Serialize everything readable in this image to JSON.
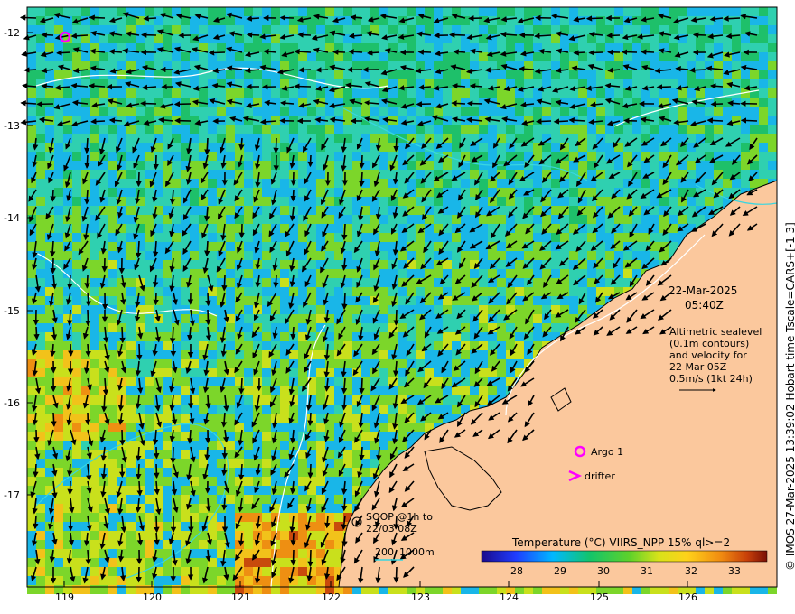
{
  "map": {
    "date": "22-Mar-2025",
    "time": "05:40Z",
    "info_lines": [
      "Altimetric sealevel",
      "(0.1m contours)",
      "and velocity for",
      "22 Mar 05Z",
      "0.5m/s (1kt 24h)"
    ],
    "argo_label": "Argo 1",
    "drifter_label": "drifter",
    "soop_lines": [
      "SOOP @1h to",
      "22/03 08Z"
    ],
    "depth_label_1": "200",
    "depth_label_2": "1000m",
    "colorbar_title": "Temperature (°C) VIIRS_NPP 15% ql>=2",
    "colorbar_ticks": [
      "28",
      "29",
      "30",
      "31",
      "32",
      "33"
    ],
    "credit": "© IMOS 27-Mar-2025 13:39:02 Hobart time Tscale=CARS+[-1 3]",
    "y_ticks": [
      "-12",
      "-13",
      "-14",
      "-15",
      "-16",
      "-17"
    ],
    "x_ticks": [
      "119",
      "120",
      "121",
      "122",
      "123",
      "124",
      "125",
      "126"
    ],
    "colors": {
      "land": "#fbc89d",
      "argo": "#ff00ff",
      "drifter": "#ff00ff",
      "contour": "#ffffff",
      "depth_200": "#39d6e0"
    }
  }
}
